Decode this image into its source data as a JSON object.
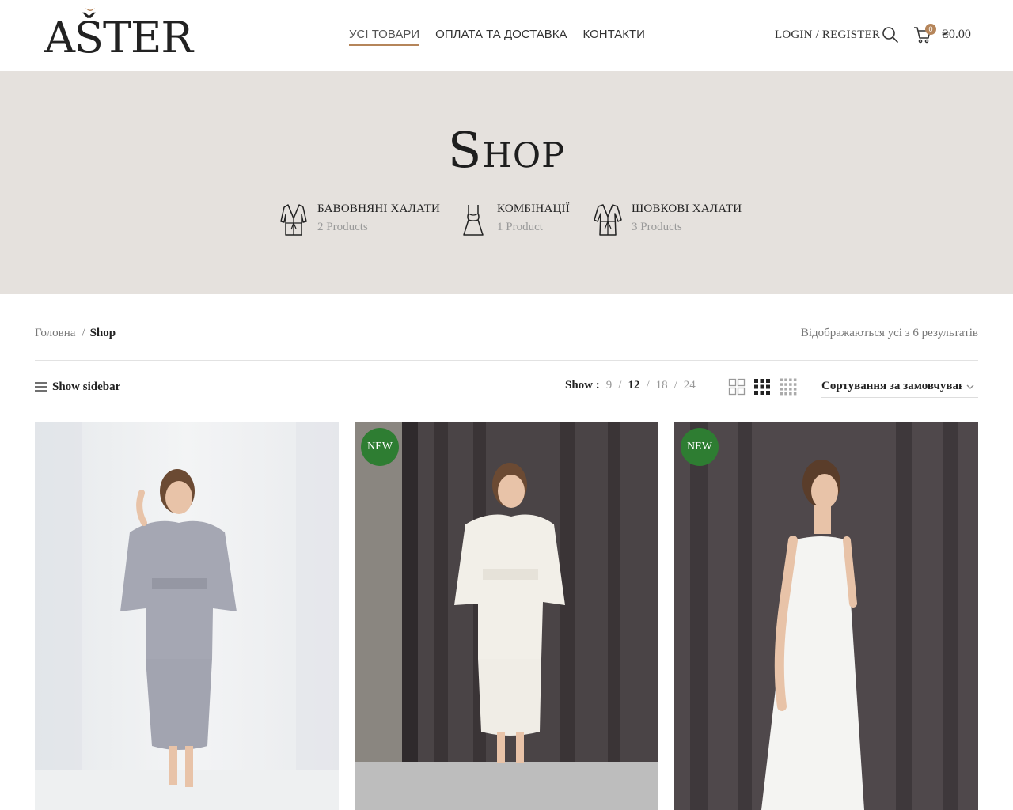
{
  "header": {
    "logo_text": "AŠTER",
    "nav": [
      {
        "label": "УСІ ТОВАРИ",
        "active": true
      },
      {
        "label": "ОПЛАТА ТА ДОСТАВКА",
        "active": false
      },
      {
        "label": "КОНТАКТИ",
        "active": false
      }
    ],
    "login_label": "Login / Register",
    "cart_count": "0",
    "cart_total": "₴0.00",
    "accent_color": "#b5855a"
  },
  "hero": {
    "title": "Shop",
    "background_color": "#e5e1dd",
    "categories": [
      {
        "name": "БАВОВНЯНІ ХАЛАТИ",
        "count": "2 Products",
        "icon": "robe-icon"
      },
      {
        "name": "КОМБІНАЦІЇ",
        "count": "1 Product",
        "icon": "slip-dress-icon"
      },
      {
        "name": "ШОВКОВІ ХАЛАТИ",
        "count": "3 Products",
        "icon": "silk-robe-icon"
      }
    ]
  },
  "breadcrumb": {
    "home": "Головна",
    "separator": "/",
    "current": "Shop"
  },
  "results_text": "Відображаються усі з 6 результатів",
  "toolbar": {
    "sidebar_label": "Show sidebar",
    "show_label": "Show :",
    "per_page_options": [
      "9",
      "12",
      "18",
      "24"
    ],
    "per_page_active": "12",
    "separator": "/",
    "sort_value": "Сортування за замовчуванням"
  },
  "products": [
    {
      "badge": "",
      "image": "woman in grey waffle bathrobe",
      "badge_color": ""
    },
    {
      "badge": "NEW",
      "image": "woman in white waffle bathrobe",
      "badge_color": "#2e7d32"
    },
    {
      "badge": "NEW",
      "image": "woman in white satin slip dress",
      "badge_color": "#2e7d32"
    }
  ]
}
